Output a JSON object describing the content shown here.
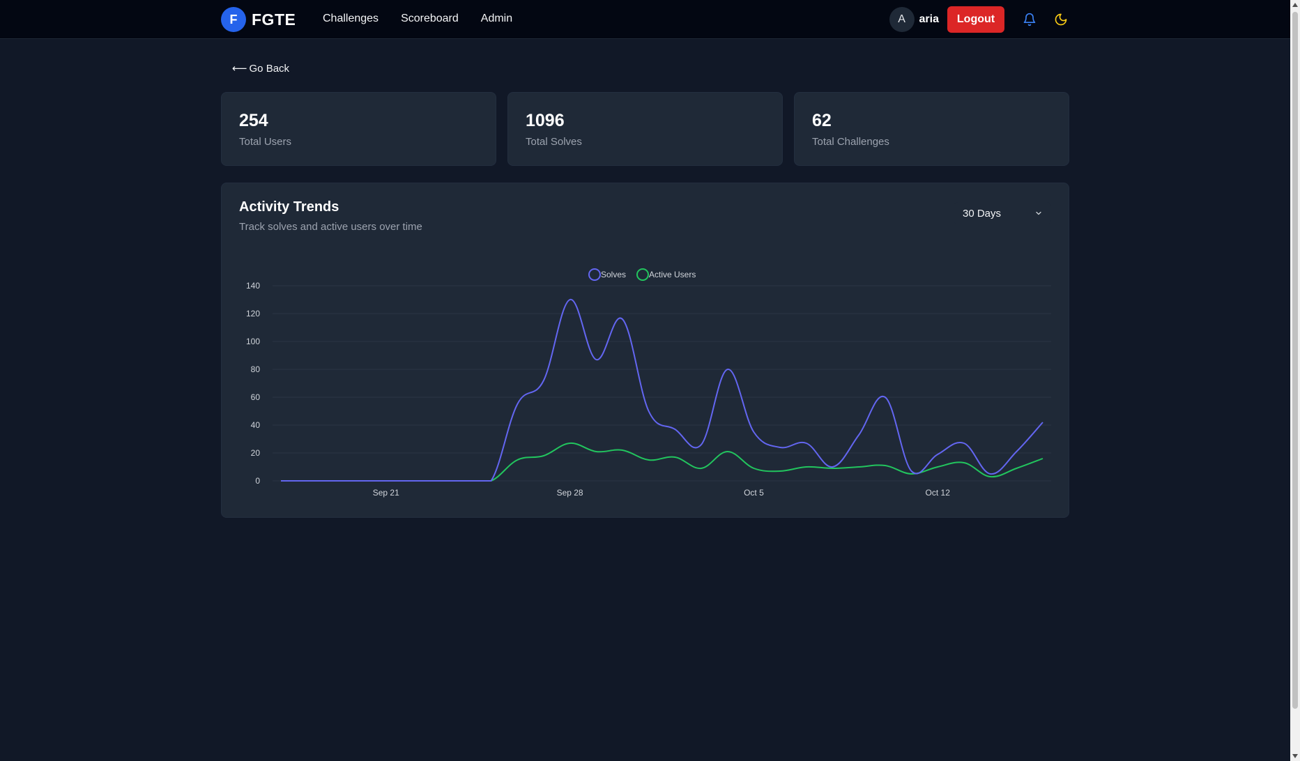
{
  "nav": {
    "brand_initial": "F",
    "brand_name": "FGTE",
    "links": [
      "Challenges",
      "Scoreboard",
      "Admin"
    ],
    "avatar_initial": "A",
    "username": "aria",
    "logout_label": "Logout",
    "bell_icon": "bell-icon",
    "theme_icon": "moon-icon"
  },
  "go_back": {
    "arrow": "⟵",
    "label": "Go Back"
  },
  "stats": [
    {
      "value": "254",
      "label": "Total Users"
    },
    {
      "value": "1096",
      "label": "Total Solves"
    },
    {
      "value": "62",
      "label": "Total Challenges"
    }
  ],
  "activity": {
    "title": "Activity Trends",
    "subtitle": "Track solves and active users over time",
    "range_selected": "30 Days"
  },
  "colors": {
    "solves": "#6366f1",
    "active_users": "#22c55e",
    "accent": "#2563eb",
    "logout": "#dc2626"
  },
  "chart_data": {
    "type": "line",
    "title": "",
    "xlabel": "",
    "ylabel": "",
    "ylim": [
      0,
      140
    ],
    "yticks": [
      0,
      20,
      40,
      60,
      80,
      100,
      120,
      140
    ],
    "x": [
      "Sep 17",
      "Sep 18",
      "Sep 19",
      "Sep 20",
      "Sep 21",
      "Sep 22",
      "Sep 23",
      "Sep 24",
      "Sep 25",
      "Sep 26",
      "Sep 27",
      "Sep 28",
      "Sep 29",
      "Sep 30",
      "Oct 1",
      "Oct 2",
      "Oct 3",
      "Oct 4",
      "Oct 5",
      "Oct 6",
      "Oct 7",
      "Oct 8",
      "Oct 9",
      "Oct 10",
      "Oct 11",
      "Oct 12",
      "Oct 13",
      "Oct 14",
      "Oct 15",
      "Oct 16"
    ],
    "xtick_labels": [
      "Sep 21",
      "Sep 28",
      "Oct 5",
      "Oct 12"
    ],
    "legend_position": "top-center",
    "grid": true,
    "series": [
      {
        "name": "Solves",
        "values": [
          0,
          0,
          0,
          0,
          0,
          0,
          0,
          0,
          0,
          55,
          72,
          130,
          87,
          116,
          50,
          37,
          26,
          80,
          35,
          24,
          27,
          10,
          33,
          60,
          7,
          19,
          27,
          5,
          21,
          42
        ]
      },
      {
        "name": "Active Users",
        "values": [
          0,
          0,
          0,
          0,
          0,
          0,
          0,
          0,
          0,
          15,
          18,
          27,
          21,
          22,
          15,
          17,
          9,
          21,
          9,
          7,
          10,
          9,
          10,
          11,
          5,
          10,
          13,
          3,
          9,
          16
        ]
      }
    ]
  }
}
